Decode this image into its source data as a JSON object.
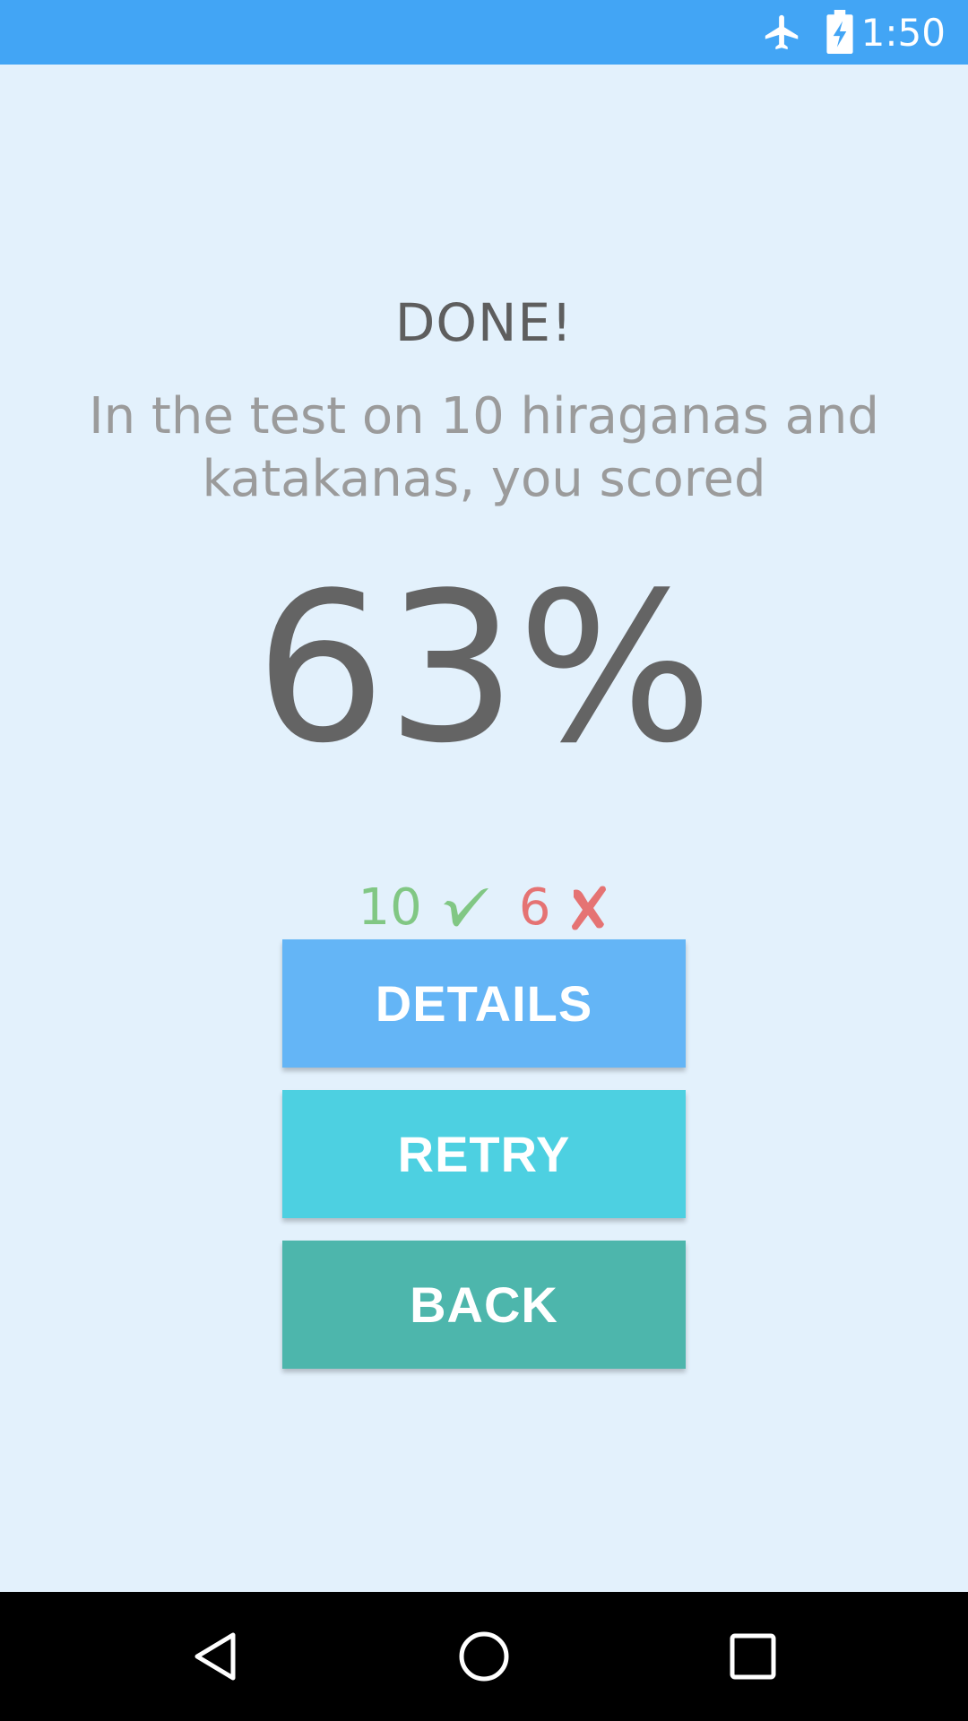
{
  "status_bar": {
    "time": "1:50",
    "icons": [
      "airplane-mode-icon",
      "battery-charging-icon"
    ],
    "color": "#42A5F5"
  },
  "result": {
    "title": "DONE!",
    "subtitle": "In the test on 10 hiraganas and katakanas, you scored",
    "score": "63%",
    "correct_count": "10",
    "wrong_count": "6",
    "correct_color": "#81C784",
    "wrong_color": "#E57373"
  },
  "buttons": {
    "details_label": "DETAILS",
    "retry_label": "RETRY",
    "back_label": "BACK",
    "details_color": "#64B5F6",
    "retry_color": "#4DD0E1",
    "back_color": "#4DB6AC"
  },
  "nav_bar": {
    "icons": [
      "back-triangle-icon",
      "home-circle-icon",
      "recents-square-icon"
    ]
  }
}
